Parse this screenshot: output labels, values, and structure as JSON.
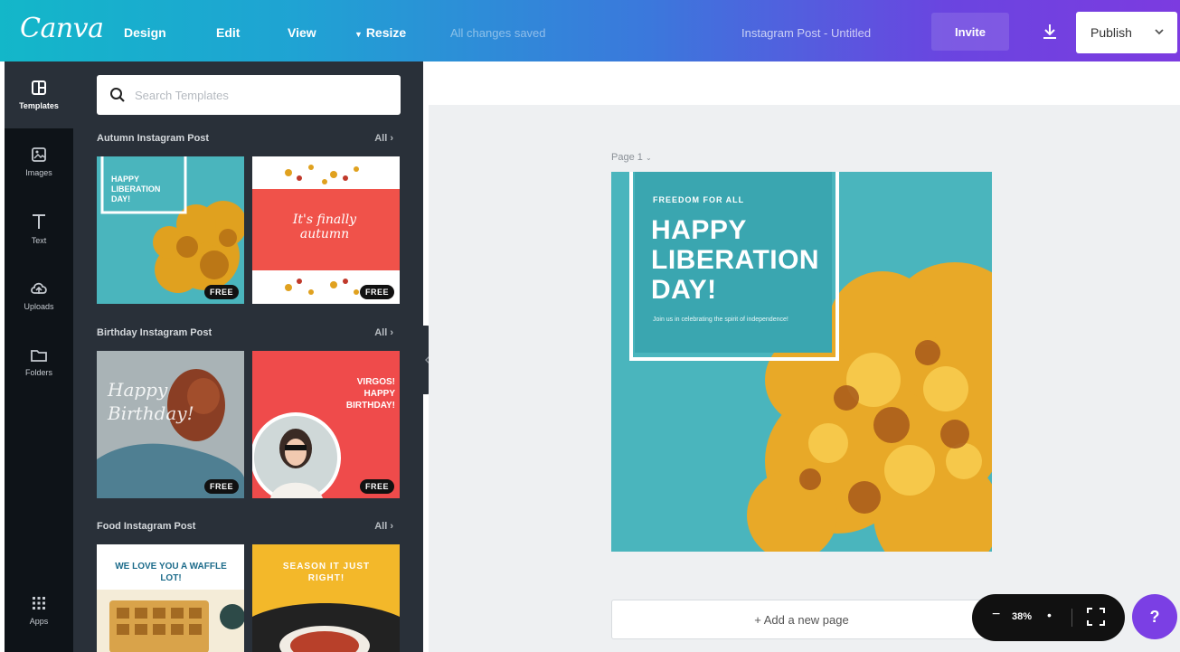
{
  "topbar": {
    "logo": "Canva",
    "nav": {
      "design": "Design",
      "edit": "Edit",
      "view": "View",
      "resize": "Resize"
    },
    "save_status": "All changes saved",
    "doc_title": "Instagram Post - Untitled",
    "invite_label": "Invite",
    "publish_label": "Publish",
    "colors": {
      "gradient_start": "#13b7c9",
      "gradient_end": "#7c3be0"
    }
  },
  "sidebar": {
    "items": [
      {
        "label": "Templates",
        "icon": "templates-icon"
      },
      {
        "label": "Images",
        "icon": "image-icon"
      },
      {
        "label": "Text",
        "icon": "text-icon"
      },
      {
        "label": "Uploads",
        "icon": "upload-icon"
      },
      {
        "label": "Folders",
        "icon": "folder-icon"
      },
      {
        "label": "Apps",
        "icon": "apps-icon"
      }
    ]
  },
  "templates_panel": {
    "search_placeholder": "Search Templates",
    "sections": [
      {
        "title": "Autumn Instagram Post",
        "all_label": "All",
        "thumbs": [
          {
            "text": "HAPPY LIBERATION DAY!",
            "badge": "FREE"
          },
          {
            "text": "It's finally autumn",
            "badge": "FREE"
          }
        ]
      },
      {
        "title": "Birthday Instagram Post",
        "all_label": "All",
        "thumbs": [
          {
            "text": "Happy Birthday!",
            "badge": "FREE"
          },
          {
            "text": "VIRGOS! HAPPY BIRTHDAY!",
            "badge": "FREE"
          }
        ]
      },
      {
        "title": "Food Instagram Post",
        "all_label": "All",
        "thumbs": [
          {
            "text": "WE LOVE YOU A WAFFLE LOT!"
          },
          {
            "text": "SEASON IT JUST RIGHT!"
          }
        ]
      }
    ]
  },
  "canvas": {
    "page_label": "Page 1",
    "design": {
      "subtitle": "FREEDOM FOR ALL",
      "title_lines": [
        "HAPPY",
        "LIBERATION",
        "DAY!"
      ],
      "body": "Join us in celebrating the spirit of independence!",
      "bg_color": "#4ab5bd"
    },
    "add_page_label": "+ Add a new page",
    "zoom": {
      "value": "38%"
    },
    "help_label": "?"
  }
}
